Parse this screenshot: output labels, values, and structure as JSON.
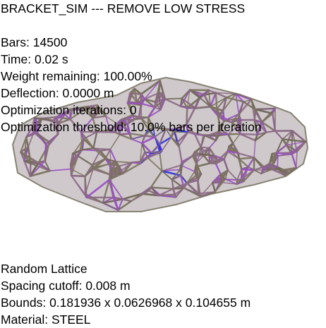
{
  "title": "BRACKET_SIM --- REMOVE LOW STRESS",
  "stats": {
    "bars": "Bars: 14500",
    "time": "Time: 0.02 s",
    "weight": "Weight remaining: 100.00%",
    "deflection": "Deflection: 0.0000 m",
    "iterations": "Optimization iterations: 0",
    "threshold": "Optimization threshold: 10.0% bars per iteration"
  },
  "lattice": {
    "type": "Random Lattice",
    "spacing": "Spacing cutoff: 0.008 m",
    "bounds": "Bounds: 0.181936 x 0.0626968 x 0.104655 m",
    "material": "Material: STEEL"
  },
  "colors": {
    "background": "#ffffff",
    "bar_olive": "#7d7560",
    "bar_mauve": "#8c6a86",
    "bar_purple": "#9a4fc6",
    "bar_blue": "#2830e6"
  },
  "icons": {
    "scene": "lattice-bracket-mesh"
  }
}
